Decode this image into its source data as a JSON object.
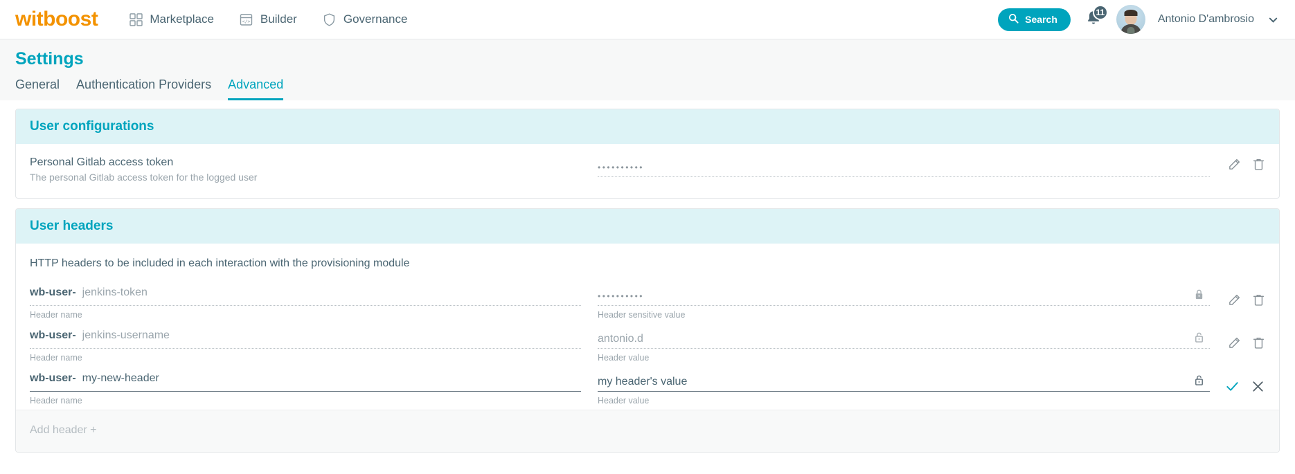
{
  "topnav": {
    "brand": "witboost",
    "items": [
      {
        "label": "Marketplace",
        "icon": "grid-icon"
      },
      {
        "label": "Builder",
        "icon": "code-icon"
      },
      {
        "label": "Governance",
        "icon": "shield-icon"
      }
    ],
    "search_label": "Search",
    "notifications_count": "11",
    "username": "Antonio D'ambrosio"
  },
  "page": {
    "title": "Settings",
    "tabs": [
      {
        "label": "General",
        "active": false
      },
      {
        "label": "Authentication Providers",
        "active": false
      },
      {
        "label": "Advanced",
        "active": true
      }
    ]
  },
  "user_configurations": {
    "title": "User configurations",
    "rows": [
      {
        "name": "Personal Gitlab access token",
        "description": "The personal Gitlab access token for the logged user",
        "value": "••••••••••",
        "edit_icon": "pencil-icon",
        "delete_icon": "trash-icon"
      }
    ]
  },
  "user_headers": {
    "title": "User headers",
    "intro": "HTTP headers to be included in each interaction with the provisioning module",
    "name_hint": "Header name",
    "prefix": "wb-user-",
    "rows": [
      {
        "name": "jenkins-token",
        "name_hint": "Header name",
        "value": "••••••••••",
        "value_hint": "Header sensitive value",
        "lock": "lock-closed-icon",
        "editing": false,
        "actions": [
          "pencil-icon",
          "trash-icon"
        ]
      },
      {
        "name": "jenkins-username",
        "name_hint": "Header name",
        "value": "antonio.d",
        "value_hint": "Header value",
        "lock": "lock-open-icon",
        "editing": false,
        "actions": [
          "pencil-icon",
          "trash-icon"
        ]
      },
      {
        "name": "my-new-header",
        "name_hint": "Header name",
        "value": "my header's value",
        "value_hint": "Header value",
        "lock": "lock-open-icon",
        "editing": true,
        "actions": [
          "check-icon",
          "close-icon"
        ]
      }
    ],
    "add_label": "Add header +"
  },
  "colors": {
    "brand_orange": "#f39200",
    "accent_teal": "#00a4bd",
    "header_band": "#ddf3f6",
    "text_slate": "#4a6572",
    "text_muted": "#9aa5ac"
  }
}
